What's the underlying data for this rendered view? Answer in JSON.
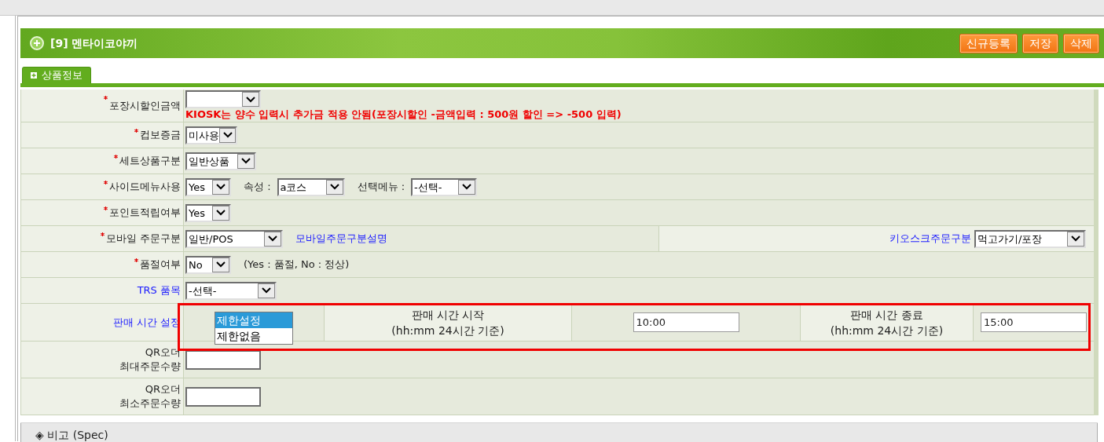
{
  "header": {
    "title": "[9] 멘타이코야끼",
    "buttons": [
      "신규등록",
      "저장",
      "삭제"
    ]
  },
  "tabs": [
    {
      "label": "상품정보",
      "selected": true
    }
  ],
  "rows": [
    {
      "kind": "fields",
      "label": "포장시할인금액",
      "required": true,
      "link": false,
      "items": [
        {
          "kind": "select"
        },
        {
          "kind": "notice",
          "text": "KIOSK는 양수 입력시 추가금 적용 안됨(포장시할인 -금액입력 : 500원 할인 => -500 입력)"
        }
      ]
    },
    {
      "kind": "fields",
      "label": "컵보증금",
      "required": true,
      "link": false,
      "items": [
        {
          "kind": "select",
          "value": "미사용"
        }
      ]
    },
    {
      "kind": "fields",
      "label": "세트상품구분",
      "required": true,
      "link": false,
      "items": [
        {
          "kind": "select",
          "value": "일반상품"
        }
      ]
    },
    {
      "kind": "fields",
      "label": "사이드메뉴사용",
      "required": true,
      "link": false,
      "items": [
        {
          "kind": "select",
          "value": "Yes"
        },
        {
          "kind": "text",
          "text": "속성 :"
        },
        {
          "kind": "select",
          "value": "a코스"
        },
        {
          "kind": "text",
          "text": "선택메뉴 :"
        },
        {
          "kind": "select",
          "value": "-선택-"
        }
      ]
    },
    {
      "kind": "fields",
      "label": "포인트적립여부",
      "required": true,
      "link": false,
      "items": [
        {
          "kind": "select",
          "value": "Yes"
        }
      ]
    },
    {
      "kind": "split",
      "label": "모바일 주문구분",
      "required": true,
      "link": false,
      "items": [
        {
          "kind": "select",
          "value": "일반/POS"
        },
        {
          "kind": "link",
          "text": "모바일주문구분설명"
        }
      ],
      "side": {
        "label": "키오스크주문구분",
        "value": "먹고가기/포장"
      }
    },
    {
      "kind": "fields",
      "label": "품절여부",
      "required": true,
      "link": false,
      "items": [
        {
          "kind": "select",
          "value": "No"
        },
        {
          "kind": "text",
          "text": "(Yes : 품절, No : 정상)"
        }
      ]
    },
    {
      "kind": "fields",
      "label": "TRS 품목",
      "required": false,
      "link": true,
      "items": [
        {
          "kind": "select",
          "value": "-선택-"
        }
      ]
    },
    {
      "kind": "time",
      "label": "판매 시간 설정",
      "required": false,
      "link": true,
      "items": [
        {
          "kind": "listbox",
          "options": [
            {
              "label": "제한설정",
              "selected": true
            },
            {
              "label": "제한없음",
              "selected": false
            }
          ]
        },
        {
          "kind": "caption",
          "lines": [
            "판매 시간 시작",
            "(hh:mm 24시간 기준)"
          ]
        },
        {
          "kind": "input",
          "value": "10:00"
        },
        {
          "kind": "caption",
          "lines": [
            "판매 시간 종료",
            "(hh:mm 24시간 기준)"
          ]
        },
        {
          "kind": "input",
          "value": "15:00"
        }
      ]
    },
    {
      "kind": "fields",
      "label": "QR오더\n최대주문수량",
      "required": false,
      "link": false,
      "items": [
        {
          "kind": "input"
        }
      ]
    },
    {
      "kind": "fields",
      "label": "QR오더\n최소주문수량",
      "required": false,
      "link": false,
      "items": [
        {
          "kind": "input"
        }
      ]
    }
  ],
  "footer": {
    "title": "◈ 비고 (Spec)"
  }
}
